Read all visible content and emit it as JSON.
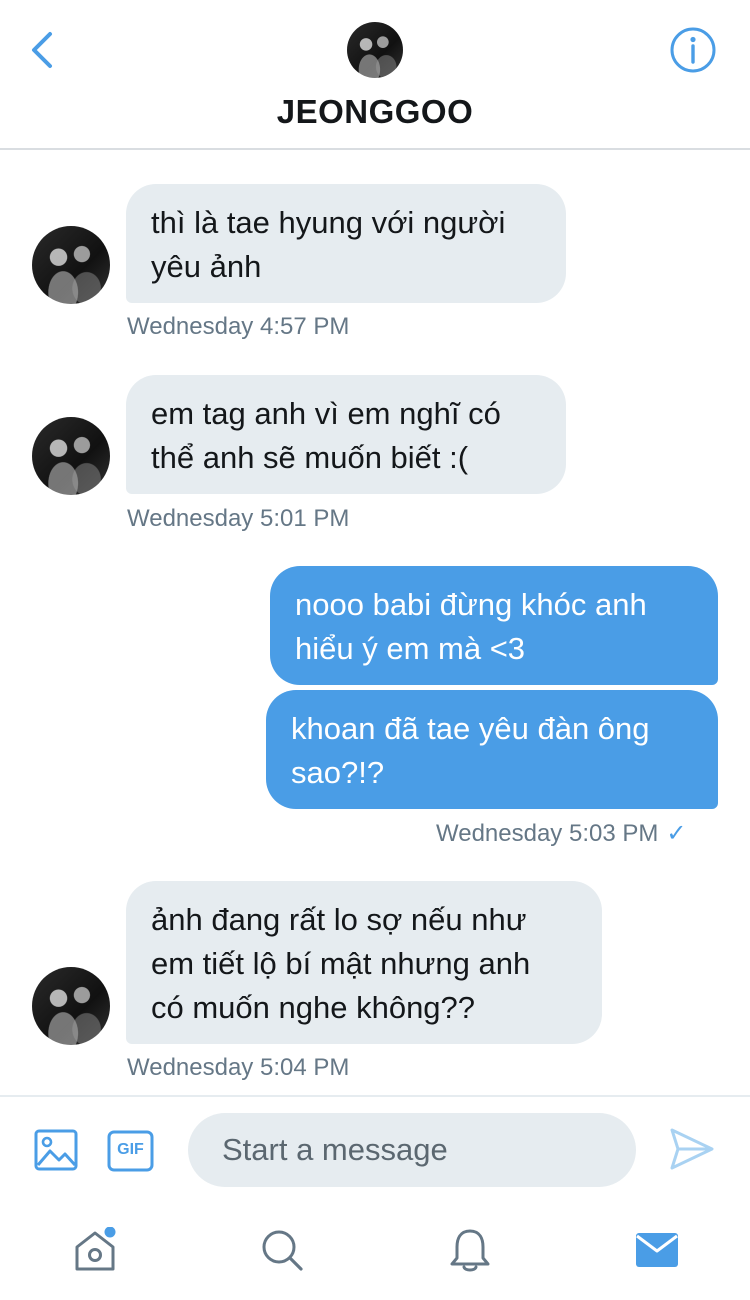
{
  "header": {
    "title": "JEONGGOO",
    "back_icon": "chevron-left-icon",
    "info_icon": "info-circle-icon",
    "accent": "#4a9de6"
  },
  "messages": [
    {
      "side": "incoming",
      "lines": [
        "thì là tae hyung với người",
        "yêu ảnh"
      ],
      "timestamp": "Wednesday 4:57 PM"
    },
    {
      "side": "incoming",
      "lines": [
        "em tag anh vì em nghĩ có",
        "thể anh sẽ muốn biết :("
      ],
      "timestamp": "Wednesday 5:01 PM"
    },
    {
      "side": "outgoing",
      "lines": [
        "nooo babi đừng khóc anh",
        "hiểu ý em mà <3"
      ]
    },
    {
      "side": "outgoing",
      "lines": [
        "khoan đã tae yêu đàn ông",
        "sao?!?"
      ],
      "timestamp": "Wednesday 5:03 PM",
      "read_icon": "checkmark-icon"
    },
    {
      "side": "incoming",
      "lines": [
        "ảnh đang rất lo sợ nếu như",
        "em tiết lộ bí mật nhưng anh",
        "có muốn nghe không??"
      ],
      "timestamp": "Wednesday 5:04 PM"
    }
  ],
  "composer": {
    "placeholder": "Start a message",
    "image_icon": "image-icon",
    "gif_icon": "gif-icon",
    "gif_label": "GIF",
    "send_icon": "send-icon"
  },
  "tabbar": {
    "items": [
      "home-icon",
      "search-icon",
      "notifications-icon",
      "messages-icon"
    ],
    "active": "messages-icon",
    "home_has_badge": true
  },
  "colors": {
    "incoming_bubble": "#e6ecf0",
    "outgoing_bubble": "#4a9de6",
    "timestamp": "#657786"
  }
}
